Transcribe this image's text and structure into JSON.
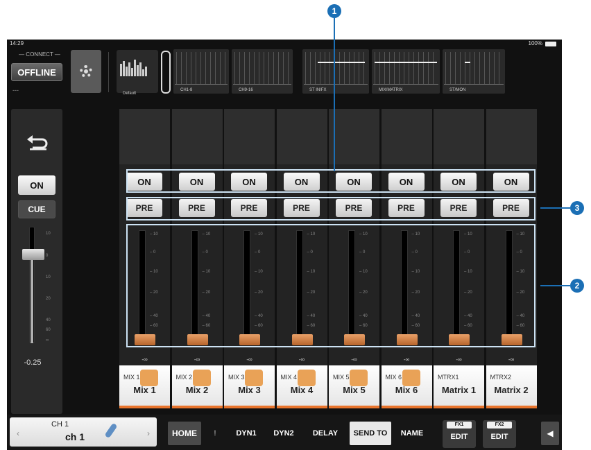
{
  "callouts": [
    "1",
    "2",
    "3"
  ],
  "status": {
    "time": "14:29",
    "battery": "100%"
  },
  "connect": {
    "label": "— CONNECT —",
    "button": "OFFLINE",
    "sub": "---"
  },
  "scene_label": "Default",
  "navigator": [
    "CH1-8",
    "CH9-16",
    "ST IN/FX",
    "MIX/MATRIX",
    "ST/MON"
  ],
  "left_strip": {
    "on": "ON",
    "cue": "CUE",
    "scale": [
      "10",
      "0",
      "10",
      "20",
      "40",
      "60",
      "∞"
    ],
    "value": "-0.25"
  },
  "fader_scale": [
    "– 10",
    "– 0",
    "– 10",
    "– 20",
    "– 40",
    "– 60"
  ],
  "channels": [
    {
      "on": "ON",
      "pre": "PRE",
      "value": "-∞",
      "small": "MIX 1",
      "name": "Mix 1"
    },
    {
      "on": "ON",
      "pre": "PRE",
      "value": "-∞",
      "small": "MIX 2",
      "name": "Mix 2"
    },
    {
      "on": "ON",
      "pre": "PRE",
      "value": "-∞",
      "small": "MIX 3",
      "name": "Mix 3"
    },
    {
      "on": "ON",
      "pre": "PRE",
      "value": "-∞",
      "small": "MIX 4",
      "name": "Mix 4"
    },
    {
      "on": "ON",
      "pre": "PRE",
      "value": "-∞",
      "small": "MIX 5",
      "name": "Mix 5"
    },
    {
      "on": "ON",
      "pre": "PRE",
      "value": "-∞",
      "small": "MIX 6",
      "name": "Mix 6"
    },
    {
      "on": "ON",
      "pre": "PRE",
      "value": "-∞",
      "small": "MTRX1",
      "name": "Matrix 1"
    },
    {
      "on": "ON",
      "pre": "PRE",
      "value": "-∞",
      "small": "MTRX2",
      "name": "Matrix 2"
    }
  ],
  "bottom": {
    "ch_num": "CH 1",
    "ch_name": "ch 1",
    "tabs": [
      "HOME",
      "!",
      "DYN1",
      "DYN2",
      "DELAY",
      "SEND TO",
      "NAME"
    ],
    "active_tab": "SEND TO",
    "fx": [
      {
        "label": "FX1",
        "edit": "EDIT"
      },
      {
        "label": "FX2",
        "edit": "EDIT"
      }
    ]
  }
}
